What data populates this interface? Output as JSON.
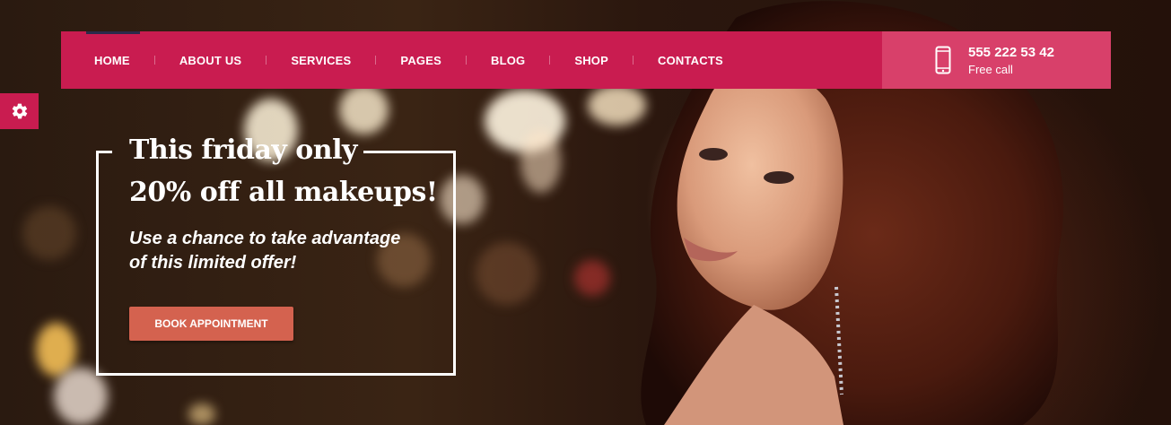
{
  "nav": {
    "items": [
      {
        "label": "HOME"
      },
      {
        "label": "ABOUT US"
      },
      {
        "label": "SERVICES"
      },
      {
        "label": "PAGES"
      },
      {
        "label": "BLOG"
      },
      {
        "label": "SHOP"
      },
      {
        "label": "CONTACTS"
      }
    ],
    "active": "HOME"
  },
  "contact": {
    "phone": "555 222 53 42",
    "label": "Free call",
    "icon": "mobile-phone-icon"
  },
  "settings": {
    "icon": "gear-icon"
  },
  "promo": {
    "title_line1": "This friday only",
    "title_line2": "20% off all makeups!",
    "subtitle_line1": "Use a chance to take advantage",
    "subtitle_line2": "of this limited offer!",
    "button_label": "BOOK APPOINTMENT"
  },
  "colors": {
    "brand": "#c91c50",
    "contact_bg": "#d8406a",
    "button": "#d4624f",
    "active_marker": "#2a2a4a"
  }
}
